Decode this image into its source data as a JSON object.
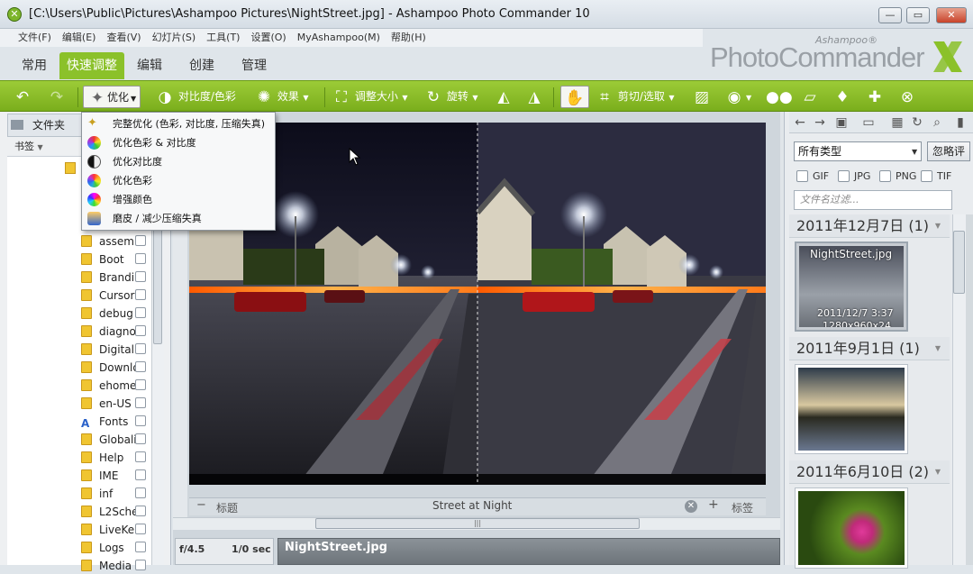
{
  "window": {
    "title": "[C:\\Users\\Public\\Pictures\\Ashampoo Pictures\\NightStreet.jpg] - Ashampoo Photo Commander 10",
    "minimize_label": "—",
    "maximize_label": "▭",
    "close_label": "✕"
  },
  "menu": [
    "文件(F)",
    "编辑(E)",
    "查看(V)",
    "幻灯片(S)",
    "工具(T)",
    "设置(O)",
    "MyAshampoo(M)",
    "帮助(H)"
  ],
  "brand": {
    "small": "Ashampoo®",
    "big": "PhotoCommander"
  },
  "tabs": [
    "常用",
    "快速调整",
    "编辑",
    "创建",
    "管理"
  ],
  "active_tab": "快速调整",
  "toolbar": {
    "optimize": "优化",
    "contrast_color": "对比度/色彩",
    "effects": "效果",
    "resize": "调整大小",
    "rotate": "旋转",
    "crop": "剪切/选取"
  },
  "dropdown": [
    {
      "label": "完整优化 (色彩, 对比度, 压缩失真)",
      "icon": "magic-wand-icon"
    },
    {
      "label": "优化色彩 & 对比度",
      "icon": "color-contrast-icon"
    },
    {
      "label": "优化对比度",
      "icon": "contrast-icon"
    },
    {
      "label": "优化色彩",
      "icon": "color-wheel-icon"
    },
    {
      "label": "增强颜色",
      "icon": "enhance-color-icon"
    },
    {
      "label": "磨皮 / 减少压缩失真",
      "icon": "smooth-skin-icon"
    }
  ],
  "left_panel": {
    "folders_tab": "文件夹",
    "bookmarks": "书签",
    "folders": [
      "assem",
      "Boot",
      "Brandi",
      "Cursor",
      "debug",
      "diagno",
      "Digital",
      "Downlo",
      "ehome",
      "en-US",
      "Fonts",
      "Globali",
      "Help",
      "IME",
      "inf",
      "L2Sche",
      "LiveKer",
      "Logs",
      "Media"
    ]
  },
  "viewer": {
    "title_label_left": "标题",
    "caption": "Street at Night",
    "title_label_right": "标签"
  },
  "info": {
    "fstop": "f/4.5",
    "shutter": "1/0 sec",
    "filename": "NightStreet.jpg"
  },
  "right_panel": {
    "type_select": "所有类型",
    "ignore_button": "忽略评",
    "formats": [
      "GIF",
      "JPG",
      "PNG",
      "TIF"
    ],
    "filter_placeholder": "文件名过滤...",
    "groups": [
      {
        "date": "2011年12月7日 (1)"
      },
      {
        "date": "2011年9月1日 (1)"
      },
      {
        "date": "2011年6月10日 (2)"
      }
    ],
    "thumb1": {
      "name": "NightStreet.jpg",
      "date": "2011/12/7 3:37",
      "size": "1280x960x24"
    }
  },
  "colors": {
    "accent_green": "#8bc12a",
    "toolbar_green": "#7aae1c"
  }
}
